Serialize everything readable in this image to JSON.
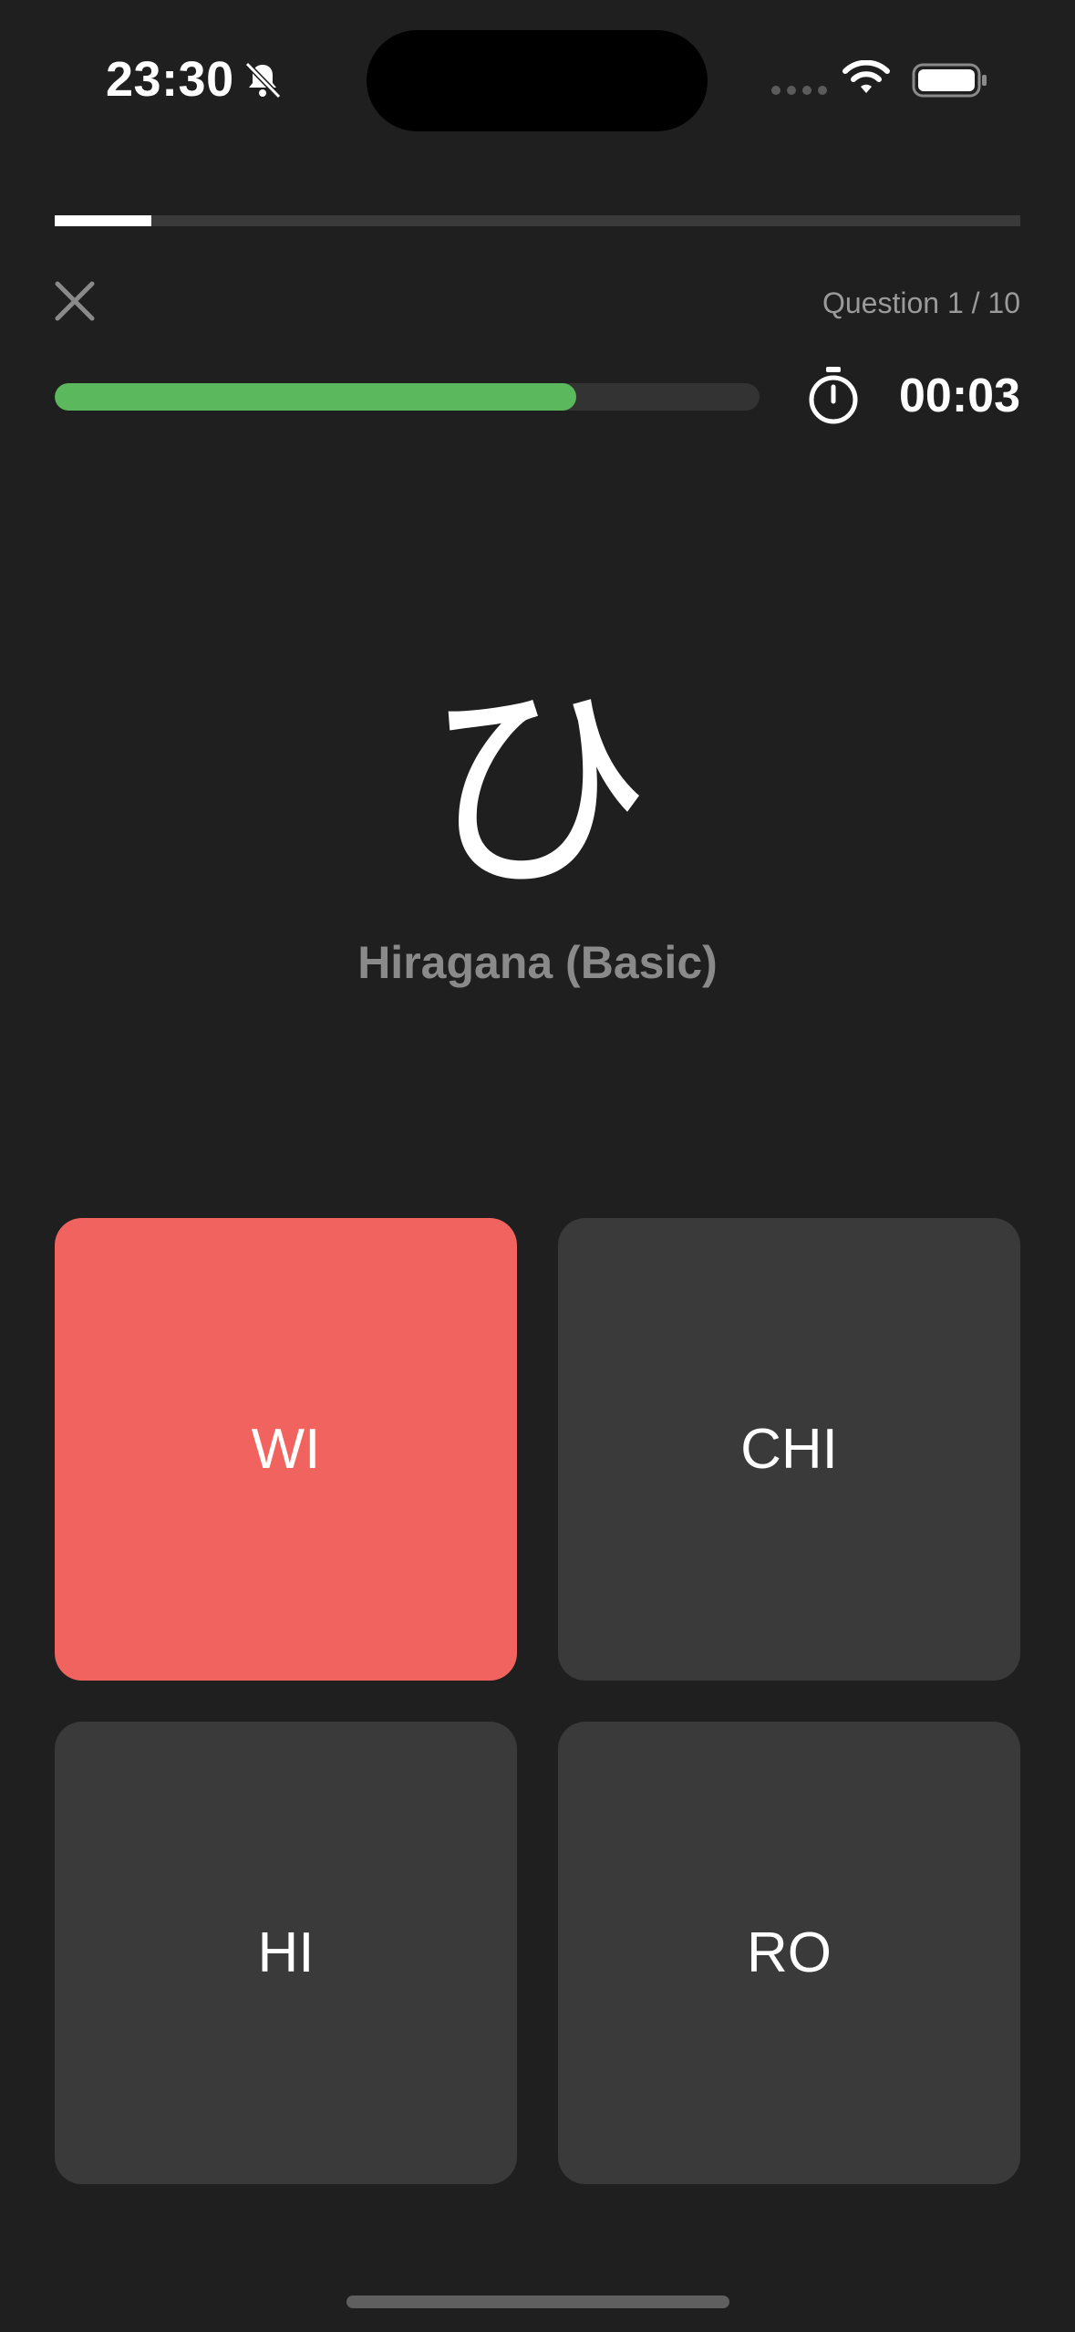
{
  "status_bar": {
    "time": "23:30",
    "icons": [
      "bell-slash-icon",
      "signal-dots-icon",
      "wifi-icon",
      "battery-icon"
    ]
  },
  "quiz": {
    "progress_fraction": 0.1,
    "question_counter": "Question 1 / 10",
    "time_remaining_fraction": 0.74,
    "timer": "00:03",
    "character": "ひ",
    "set_label": "Hiragana (Basic)"
  },
  "answers": [
    {
      "label": "WI",
      "state": "wrong"
    },
    {
      "label": "CHI",
      "state": "default"
    },
    {
      "label": "HI",
      "state": "default"
    },
    {
      "label": "RO",
      "state": "default"
    }
  ],
  "colors": {
    "background": "#1f1f1f",
    "wrong": "#f0635f",
    "timer_fill": "#5cb85c",
    "tile": "#3a3a3a"
  }
}
